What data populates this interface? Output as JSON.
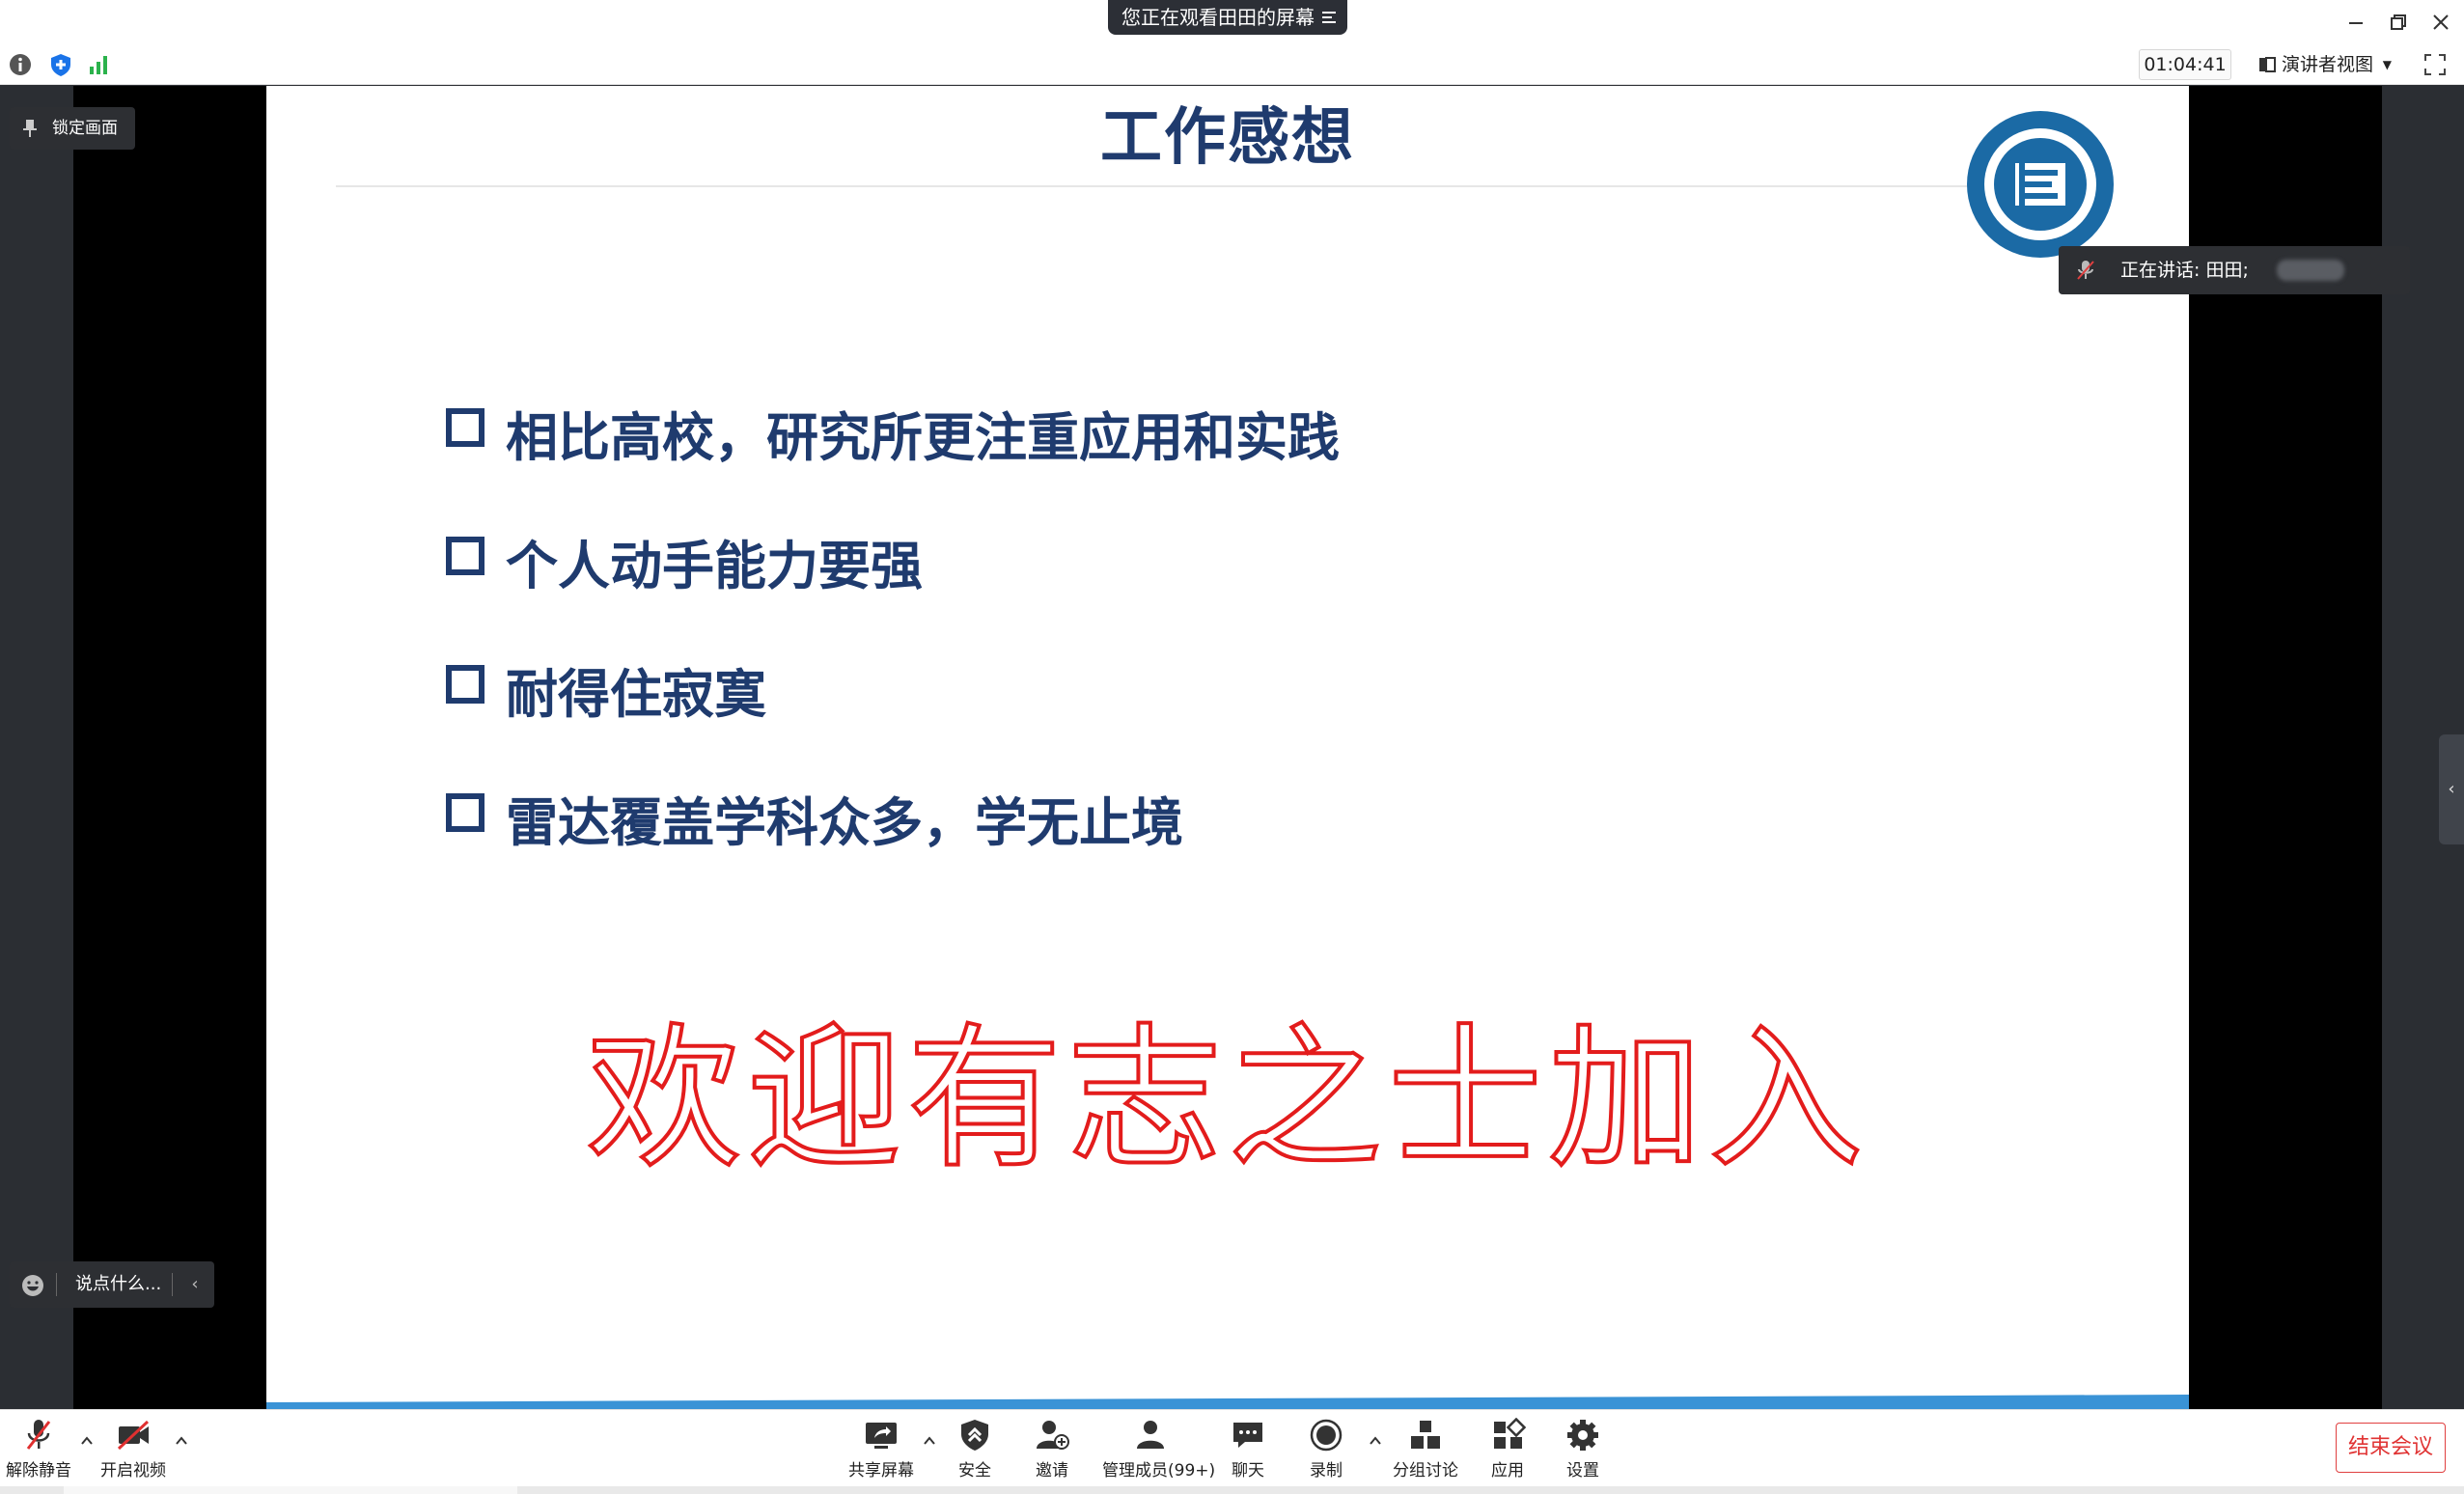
{
  "titlebar": {
    "viewing_banner": "您正在观看田田的屏幕",
    "window_controls": [
      "minimize-icon",
      "restore-icon",
      "close-icon"
    ]
  },
  "toolbar": {
    "left_icons": [
      "info-icon",
      "shield-icon",
      "signal-icon"
    ],
    "timer": "01:04:41",
    "view_mode": "演讲者视图",
    "fullscreen_icon": "fullscreen-icon"
  },
  "overlays": {
    "lock_screen": "锁定画面",
    "speaking_label": "正在讲话: 田田;",
    "chat_placeholder": "说点什么..."
  },
  "slide": {
    "title": "工作感想",
    "bullets": [
      "相比高校，研究所更注重应用和实践",
      "个人动手能力要强",
      "耐得住寂寞",
      "雷达覆盖学科众多，学无止境"
    ],
    "welcome": "欢迎有志之士加入",
    "colors": {
      "title": "#1f3b6e",
      "welcome_outline": "#e31c1c",
      "logo": "#1b6aa5"
    }
  },
  "bottombar": {
    "unmute": "解除静音",
    "start_video": "开启视频",
    "share_screen": "共享屏幕",
    "security": "安全",
    "invite": "邀请",
    "manage_members": "管理成员(99+)",
    "chat": "聊天",
    "record": "录制",
    "breakout": "分组讨论",
    "apps": "应用",
    "settings": "设置",
    "end_meeting": "结束会议"
  }
}
